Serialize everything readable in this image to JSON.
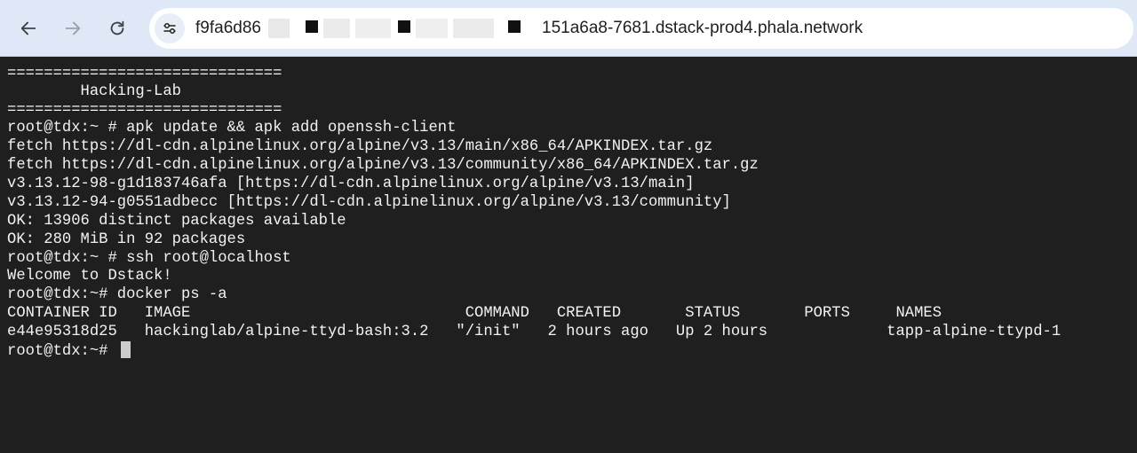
{
  "browser": {
    "url_start": "f9fa6d86",
    "url_end": "151a6a8-7681.dstack-prod4.phala.network",
    "back_icon": "arrow-left-icon",
    "forward_icon": "arrow-right-icon",
    "reload_icon": "reload-icon",
    "site_info_icon": "tune-icon"
  },
  "terminal": {
    "lines": [
      "==============================",
      "        Hacking-Lab",
      "==============================",
      "root@tdx:~ # apk update && apk add openssh-client",
      "fetch https://dl-cdn.alpinelinux.org/alpine/v3.13/main/x86_64/APKINDEX.tar.gz",
      "fetch https://dl-cdn.alpinelinux.org/alpine/v3.13/community/x86_64/APKINDEX.tar.gz",
      "v3.13.12-98-g1d183746afa [https://dl-cdn.alpinelinux.org/alpine/v3.13/main]",
      "v3.13.12-94-g0551adbecc [https://dl-cdn.alpinelinux.org/alpine/v3.13/community]",
      "OK: 13906 distinct packages available",
      "OK: 280 MiB in 92 packages",
      "root@tdx:~ # ssh root@localhost",
      "Welcome to Dstack!",
      "root@tdx:~# docker ps -a",
      "CONTAINER ID   IMAGE                              COMMAND   CREATED       STATUS       PORTS     NAMES",
      "e44e95318d25   hackinglab/alpine-ttyd-bash:3.2   \"/init\"   2 hours ago   Up 2 hours             tapp-alpine-ttypd-1",
      "root@tdx:~# "
    ]
  }
}
